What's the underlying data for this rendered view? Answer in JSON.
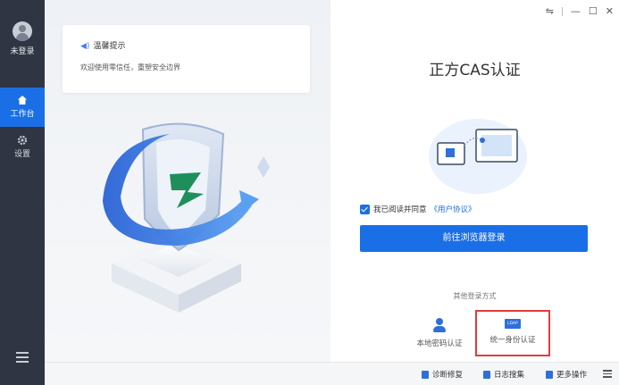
{
  "sidebar": {
    "user_label": "未登录",
    "items": [
      {
        "label": "工作台",
        "icon": "home-icon",
        "active": true
      },
      {
        "label": "设置",
        "icon": "gear-icon",
        "active": false
      }
    ],
    "menu_icon": "menu-icon"
  },
  "notice": {
    "title": "温馨提示",
    "text": "欢迎使用零信任，重塑安全边界"
  },
  "main": {
    "title": "正方CAS认证",
    "agree_text": "我已阅读并同意",
    "agreement_link": "《用户协议》",
    "browser_login_label": "前往浏览器登录",
    "other_methods_label": "其他登录方式",
    "options": [
      {
        "label": "本地密码认证",
        "icon": "user-icon"
      },
      {
        "label": "统一身份认证",
        "icon": "ldap-icon",
        "icon_text": "LDAP",
        "highlighted": true
      }
    ]
  },
  "window_controls": [
    "swap-icon",
    "minimize-icon",
    "maximize-icon",
    "close-icon"
  ],
  "bottom": {
    "items": [
      {
        "label": "诊断修复",
        "icon": "lock-icon"
      },
      {
        "label": "日志搜集",
        "icon": "document-icon"
      },
      {
        "label": "更多操作",
        "icon": "more-icon"
      }
    ]
  },
  "colors": {
    "accent": "#1a6fe6",
    "sidebar": "#2f3542",
    "highlight_border": "#e23b3b"
  }
}
